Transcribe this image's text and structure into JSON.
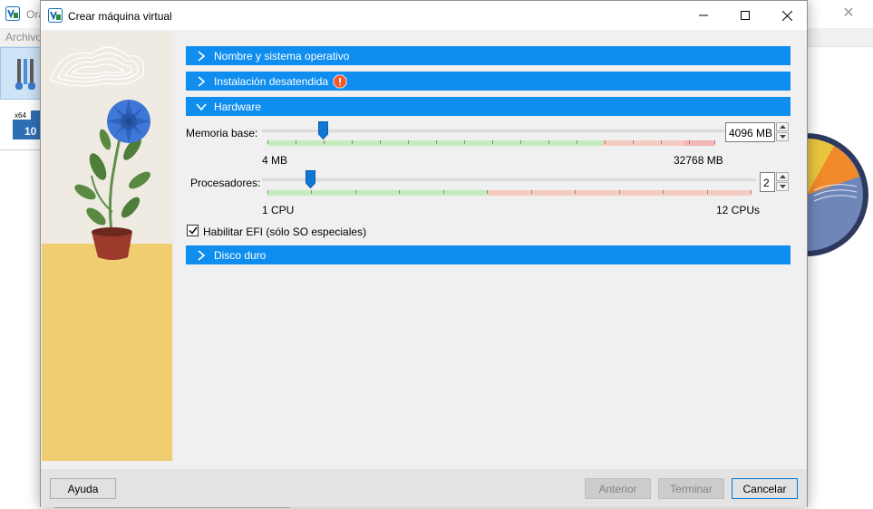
{
  "background_window": {
    "title": "Ora",
    "menu_item": "Archivo",
    "vm_badge": "x64",
    "vm_badge_number": "10"
  },
  "dialog": {
    "title": "Crear máquina virtual",
    "sections": {
      "name_os": {
        "label": "Nombre y sistema operativo",
        "expanded": false
      },
      "unattended": {
        "label": "Instalación desatendida",
        "expanded": false,
        "warning": true
      },
      "hardware": {
        "label": "Hardware",
        "expanded": true
      },
      "disk": {
        "label": "Disco duro",
        "expanded": false
      }
    },
    "hardware": {
      "memory": {
        "label": "Memoria base:",
        "value": "4096 MB",
        "min_label": "4 MB",
        "max_label": "32768 MB",
        "level": 0.125
      },
      "cpus": {
        "label": "Procesadores:",
        "value": "2",
        "min_label": "1 CPU",
        "max_label": "12 CPUs",
        "level": 0.0909
      },
      "efi": {
        "label": "Habilitar EFI (sólo SO especiales)",
        "checked": true
      }
    },
    "buttons": {
      "help": "Ayuda",
      "back": "Anterior",
      "finish": "Terminar",
      "cancel": "Cancelar"
    }
  },
  "colors": {
    "accent": "#0f8ef0",
    "scale_green": "#c3ecbf",
    "scale_orange": "#f6cbc0",
    "scale_red": "#f4b6b6",
    "side_wall": "#efebe3",
    "side_table": "#f1cd72"
  }
}
